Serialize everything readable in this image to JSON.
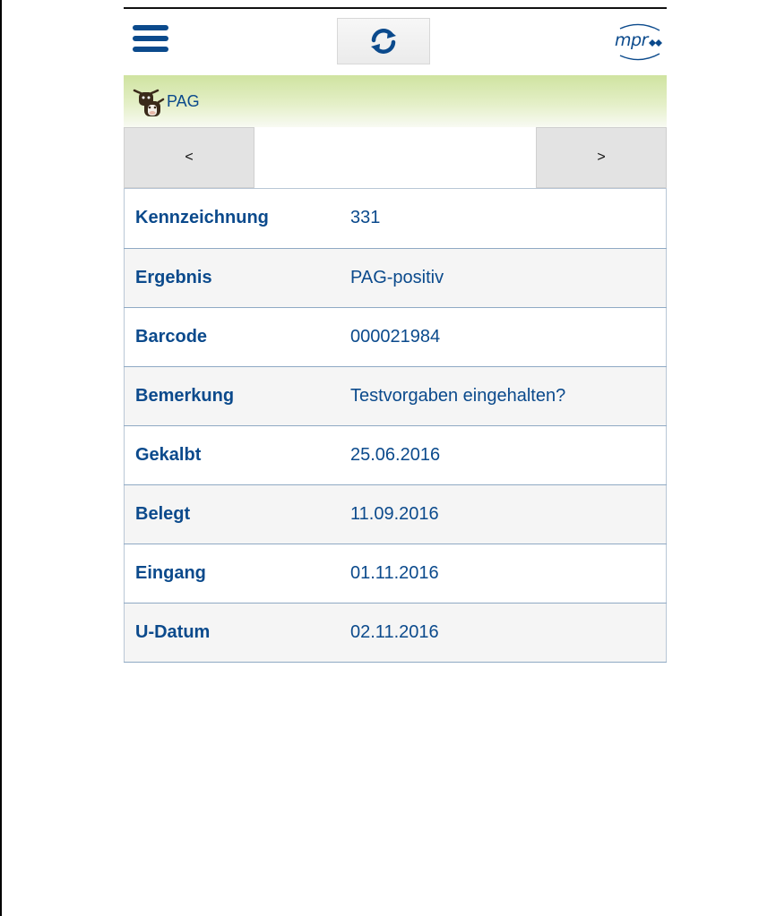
{
  "header": {
    "logo_text": "mpr",
    "menu_icon": "hamburger-menu-icon",
    "refresh_icon": "sync-icon"
  },
  "section": {
    "title": "PAG",
    "icon": "cow-icon",
    "accent_color": "#cfe3a0"
  },
  "pager": {
    "prev_label": "<",
    "next_label": ">"
  },
  "details": {
    "rows": [
      {
        "label": "Kennzeichnung",
        "value": "331"
      },
      {
        "label": "Ergebnis",
        "value": "PAG-positiv"
      },
      {
        "label": "Barcode",
        "value": "000021984"
      },
      {
        "label": "Bemerkung",
        "value": "Testvorgaben eingehalten?"
      },
      {
        "label": "Gekalbt",
        "value": "25.06.2016"
      },
      {
        "label": "Belegt",
        "value": "11.09.2016"
      },
      {
        "label": "Eingang",
        "value": "01.11.2016"
      },
      {
        "label": "U-Datum",
        "value": "02.11.2016"
      }
    ]
  },
  "colors": {
    "primary": "#0b4a8c"
  }
}
